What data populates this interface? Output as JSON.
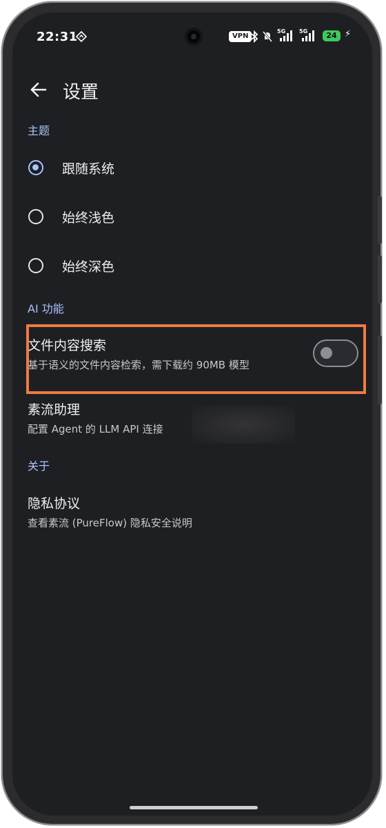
{
  "status_bar": {
    "time": "22:31",
    "vpn_label": "VPN",
    "net1": "5G",
    "net2": "5G",
    "battery_level": "24",
    "icons": [
      "diamond-location-icon",
      "bluetooth-icon",
      "mute-icon",
      "signal-icon",
      "battery-icon",
      "charging-icon"
    ]
  },
  "header": {
    "title": "设置",
    "back_icon": "arrow-left-icon"
  },
  "theme_section": {
    "label": "主题",
    "options": [
      {
        "label": "跟随系统",
        "selected": true
      },
      {
        "label": "始终浅色",
        "selected": false
      },
      {
        "label": "始终深色",
        "selected": false
      }
    ]
  },
  "ai_section": {
    "label": "AI 功能",
    "items": [
      {
        "title": "文件内容搜索",
        "subtitle": "基于语义的文件内容检索，需下载约 90MB 模型",
        "toggle_on": false
      },
      {
        "title": "素流助理",
        "subtitle": "配置 Agent 的 LLM API 连接"
      }
    ]
  },
  "about_section": {
    "label": "关于",
    "items": [
      {
        "title": "隐私协议",
        "subtitle": "查看素流 (PureFlow) 隐私安全说明"
      }
    ]
  },
  "colors": {
    "background": "#1e1f22",
    "accent": "#aac4ff",
    "highlight": "#f07a45"
  }
}
